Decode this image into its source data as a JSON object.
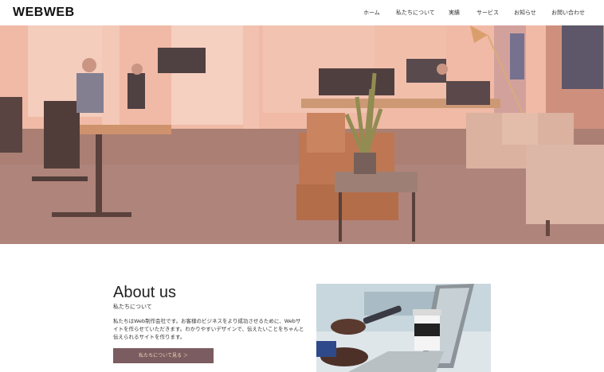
{
  "header": {
    "logo": "WEBWEB",
    "nav": [
      "ホーム",
      "私たちについて",
      "実績",
      "サービス",
      "お知らせ",
      "お問い合わせ"
    ]
  },
  "hero": {
    "image": "office-photo",
    "overlay_color": "#e8957c"
  },
  "about": {
    "title": "About us",
    "subtitle": "私たちについて",
    "body": "私たちはWeb制作会社です。お客様のビジネスをより成功させるために、Webサイトを作らせていただきます。わかりやすいデザインで、伝えたいことをちゃんと伝えられるサイトを作ります。",
    "button_label": "私たちについて見る ＞",
    "button_color": "#7b5c60",
    "image": "laptop-photo"
  }
}
